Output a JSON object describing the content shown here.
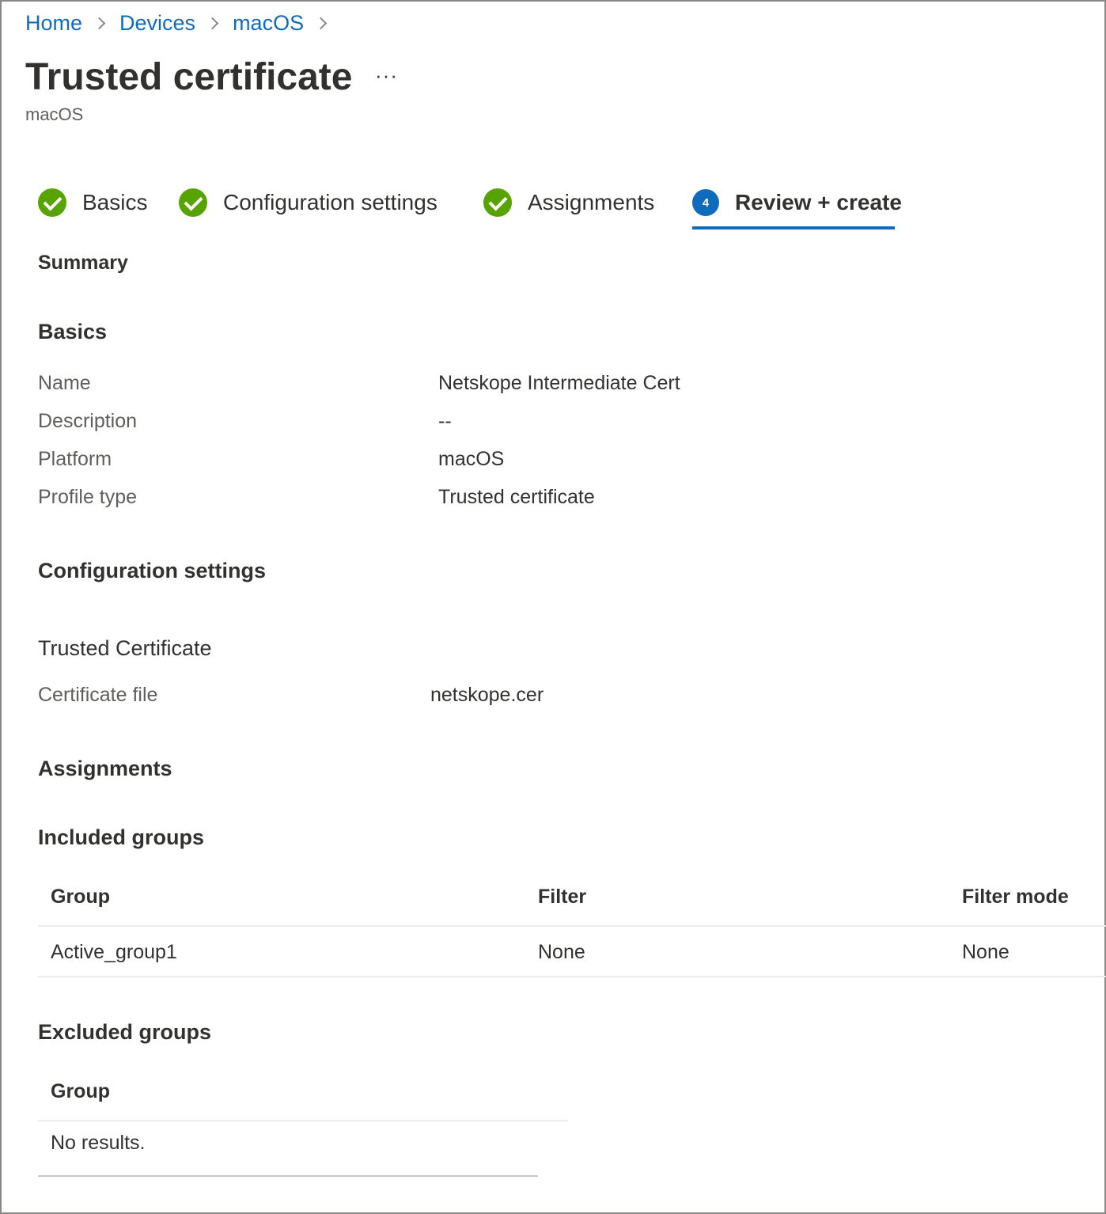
{
  "breadcrumb": {
    "items": [
      "Home",
      "Devices",
      "macOS"
    ]
  },
  "header": {
    "title": "Trusted certificate",
    "more": "···",
    "subtitle": "macOS"
  },
  "steps": [
    {
      "label": "Basics",
      "status": "complete"
    },
    {
      "label": "Configuration settings",
      "status": "complete"
    },
    {
      "label": "Assignments",
      "status": "complete"
    },
    {
      "label": "Review + create",
      "status": "active",
      "number": "4"
    }
  ],
  "summary": {
    "heading": "Summary",
    "basics": {
      "heading": "Basics",
      "rows": [
        {
          "label": "Name",
          "value": "Netskope Intermediate Cert"
        },
        {
          "label": "Description",
          "value": "--"
        },
        {
          "label": "Platform",
          "value": "macOS"
        },
        {
          "label": "Profile type",
          "value": "Trusted certificate"
        }
      ]
    },
    "configuration": {
      "heading": "Configuration settings",
      "subheading": "Trusted Certificate",
      "rows": [
        {
          "label": "Certificate file",
          "value": "netskope.cer"
        }
      ]
    },
    "assignments": {
      "heading": "Assignments",
      "included": {
        "heading": "Included groups",
        "columns": [
          "Group",
          "Filter",
          "Filter mode"
        ],
        "rows": [
          [
            "Active_group1",
            "None",
            "None"
          ]
        ]
      },
      "excluded": {
        "heading": "Excluded groups",
        "columns": [
          "Group"
        ],
        "empty_text": "No results."
      }
    }
  },
  "colors": {
    "link": "#0f6cbd",
    "complete": "#57a300",
    "active": "#0f6cbd",
    "text": "#323130",
    "muted": "#605e5c"
  }
}
